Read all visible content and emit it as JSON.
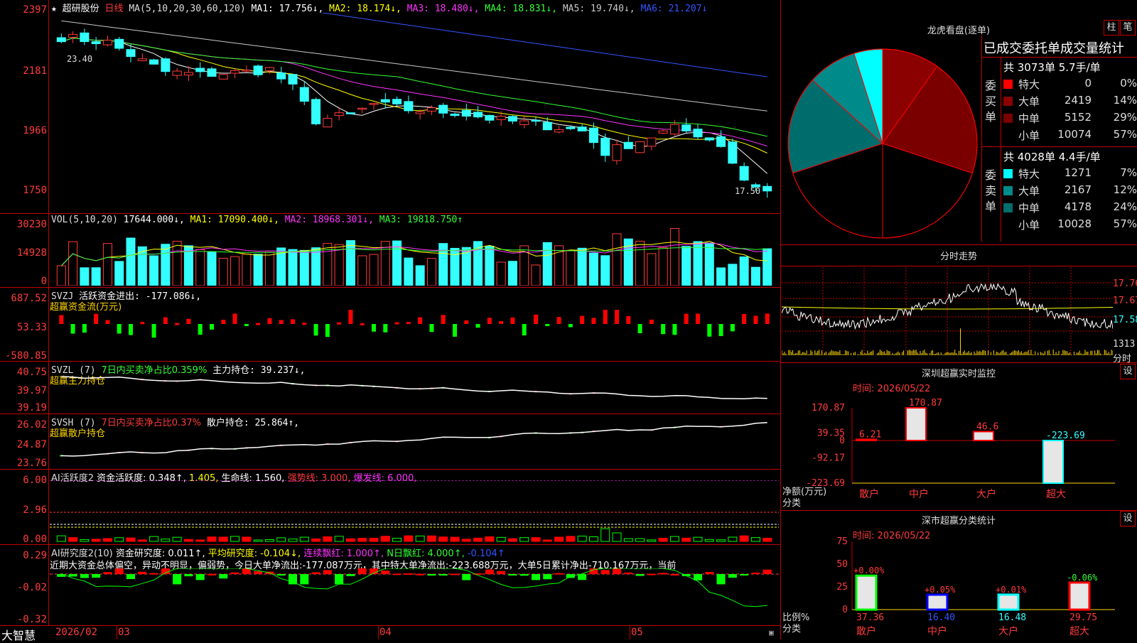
{
  "stock": {
    "star": "★",
    "name": "超研股份",
    "period": "日线"
  },
  "price_panel": {
    "ma_title": "MA(5,10,20,30,60,120)",
    "ma1": "MA1: 17.756↓,",
    "ma2": "MA2: 18.174↓,",
    "ma3": "MA3: 18.480↓,",
    "ma4": "MA4: 18.831↓,",
    "ma5": "MA5: 19.740↓,",
    "ma6": "MA6: 21.207↓",
    "yticks": [
      "2397",
      "2181",
      "1966",
      "1750"
    ],
    "high_label": "23.40",
    "low_label": "17.50"
  },
  "vol_panel": {
    "title": "VOL(5,10,20)",
    "v0": "17644.000↓,",
    "ma1": "MA1: 17090.400↓,",
    "ma2": "MA2: 18968.301↓,",
    "ma3": "MA3: 19818.750↑",
    "yticks": [
      "30230",
      "14928",
      "0"
    ]
  },
  "svzj_panel": {
    "title": "SVZJ",
    "line1": "活跃资金进出: -177.086↓,",
    "line2": "超赢资金流(万元)",
    "yticks": [
      "687.52",
      "53.33",
      "-580.85"
    ]
  },
  "svzl_panel": {
    "title": "SVZL (7)",
    "line1": "7日内买卖净占比0.359%",
    "line1b": "主力持仓: 39.237↓,",
    "line2": "超赢主力持仓",
    "yticks": [
      "40.75",
      "39.97",
      "39.19"
    ]
  },
  "svsh_panel": {
    "title": "SVSH (7)",
    "line1": "7日内买卖净占比0.37%",
    "line1b": "散户持仓: 25.864↑,",
    "line2": "超赢散户持仓",
    "yticks": [
      "26.02",
      "24.87",
      "23.76"
    ]
  },
  "ai1_panel": {
    "title": "AI活跃度2",
    "a": "资金活跃度: 0.348↑,",
    "b": "1.405,",
    "c": "生命线: 1.560,",
    "d": "强势线: 3.000,",
    "e": "爆发线: 6.000,",
    "yticks": [
      "6.00",
      "2.96",
      "0.00"
    ]
  },
  "ai2_panel": {
    "title": "AI研究度2(10)",
    "a": "资金研究度: 0.011↑,",
    "b": "平均研究度: -0.104↓,",
    "c": "连续飘红: 1.000↑,",
    "d": "N日飘红: 4.000↑,",
    "e": "-0.104↑",
    "desc": "近期大资金总体偏空，异动不明显，偏弱势，今日大单净流出:-177.087万元，其中特大单净流出:-223.688万元，大单5日累计净出-710.167万元，当前",
    "yticks": [
      "0.29",
      "-0.02",
      "-0.32"
    ]
  },
  "xaxis": {
    "brand": "大智慧",
    "d1": "2026/02",
    "d2": "03",
    "d3": "04",
    "d4": "05"
  },
  "dragon": {
    "title": "龙虎看盘(逐单)",
    "btn1": "柱",
    "btn2": "笔",
    "subtitle": "已成交委托单成交量统计",
    "buy_header": "共 3073单 5.7手/单",
    "buy_label": "委买单",
    "sell_header": "共 4028单 4.4手/单",
    "sell_label": "委卖单",
    "buy_rows": [
      {
        "name": "特大",
        "val": "0",
        "pct": "0%",
        "color": "#ff0000"
      },
      {
        "name": "大单",
        "val": "2419",
        "pct": "14%",
        "color": "#8b0000"
      },
      {
        "name": "中单",
        "val": "5152",
        "pct": "29%",
        "color": "#7a0000"
      },
      {
        "name": "小单",
        "val": "10074",
        "pct": "57%",
        "color": "#000000"
      }
    ],
    "sell_rows": [
      {
        "name": "特大",
        "val": "1271",
        "pct": "7%",
        "color": "#00ffff"
      },
      {
        "name": "大单",
        "val": "2167",
        "pct": "12%",
        "color": "#008b8b"
      },
      {
        "name": "中单",
        "val": "4178",
        "pct": "24%",
        "color": "#006d6d"
      },
      {
        "name": "小单",
        "val": "10028",
        "pct": "57%",
        "color": "#000000"
      }
    ]
  },
  "intraday": {
    "title": "分时走势",
    "p1": "17.76",
    "p2": "17.67",
    "p3": "17.58",
    "v1": "1313",
    "v2": "分时"
  },
  "monitor": {
    "title": "深圳超赢实时监控",
    "btn": "设",
    "time": "时间: 2026/05/22",
    "yticks": [
      "170.87",
      "39.35",
      "0",
      "-92.17",
      "-223.69"
    ],
    "ylabel": "净额(万元)",
    "xlabel": "分类",
    "cats": [
      "散户",
      "中户",
      "大户",
      "超大"
    ],
    "vals_text": [
      "6.21",
      "170.87",
      "46.6",
      "-223.69"
    ],
    "vals": [
      6.21,
      170.87,
      46.6,
      -223.69
    ]
  },
  "classstat": {
    "title": "深市超赢分类统计",
    "btn": "设",
    "time": "时间: 2026/05/22",
    "yticks": [
      "75",
      "50",
      "25",
      "0"
    ],
    "ylabel": "比例%",
    "xlabel": "分类",
    "cats": [
      "散户",
      "中户",
      "大户",
      "超大"
    ],
    "bar_vals": [
      37.36,
      16.4,
      16.48,
      29.75
    ],
    "bar_text": [
      "37.36",
      "16.40",
      "16.48",
      "29.75"
    ],
    "chg_text": [
      "+0.00%",
      "+0.05%",
      "+0.01%",
      "-0.06%"
    ]
  }
}
